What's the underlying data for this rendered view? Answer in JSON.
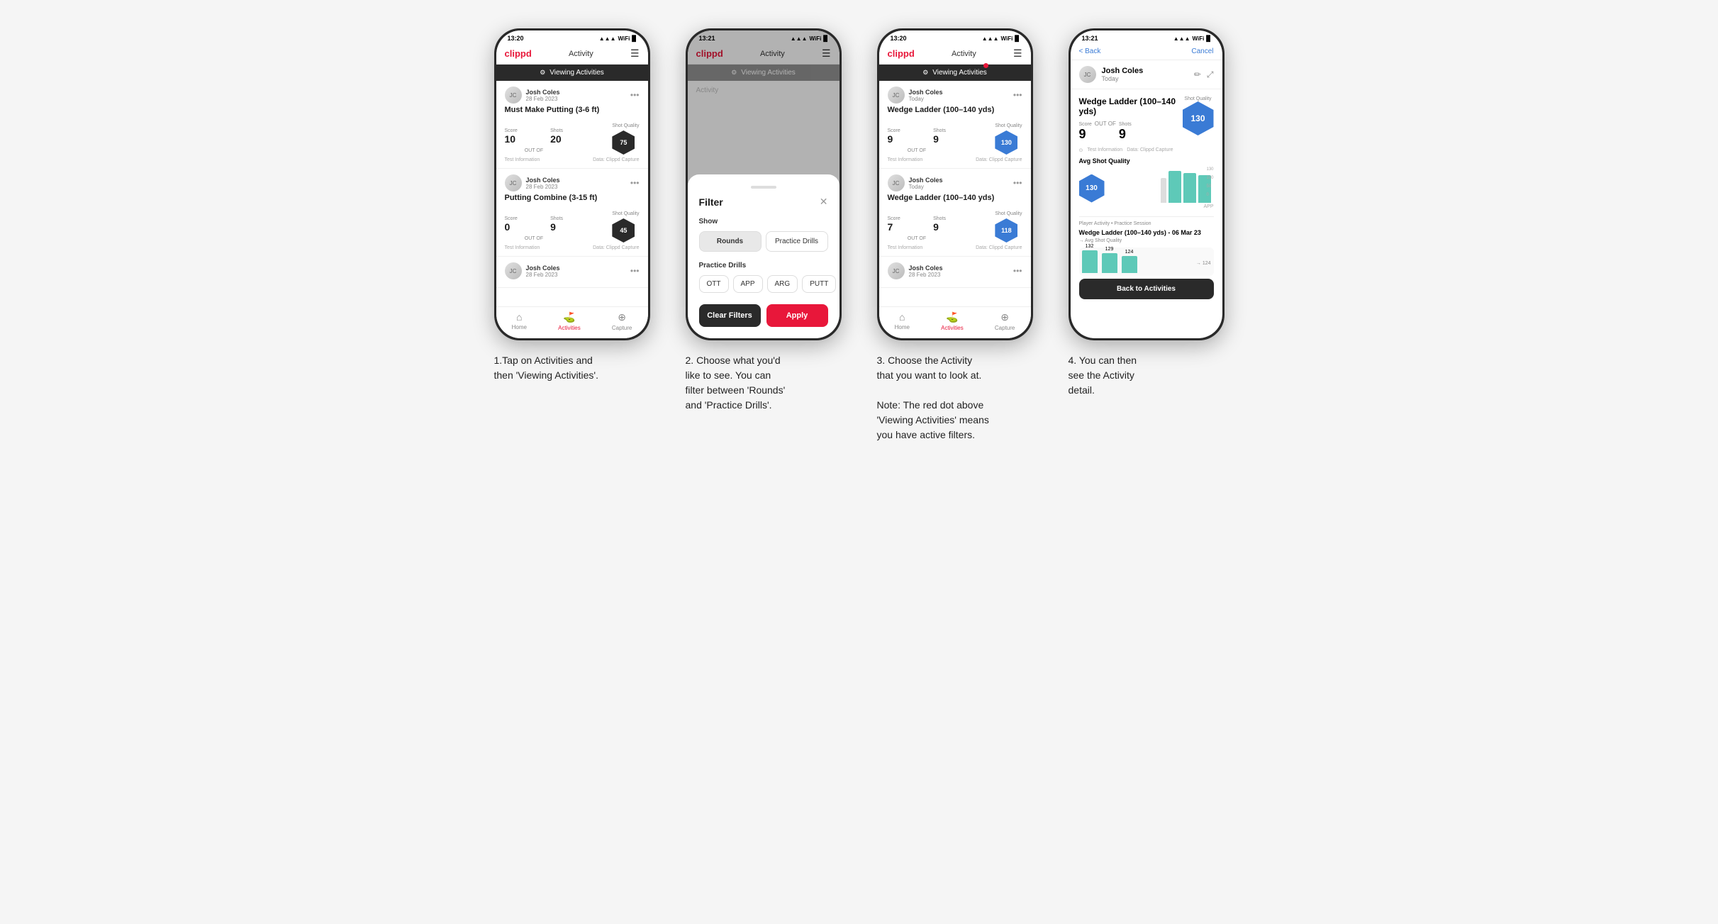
{
  "phones": [
    {
      "id": "phone1",
      "status_time": "13:20",
      "header_logo": "clippd",
      "header_title": "Activity",
      "viewing_label": "Viewing Activities",
      "has_red_dot": false,
      "activities": [
        {
          "user_name": "Josh Coles",
          "user_date": "28 Feb 2023",
          "title": "Must Make Putting (3-6 ft)",
          "score_label": "Score",
          "score_value": "10",
          "shots_label": "Shots",
          "shots_value": "20",
          "quality_label": "Shot Quality",
          "quality_value": "75",
          "info_left": "Test Information",
          "info_right": "Data: Clippd Capture"
        },
        {
          "user_name": "Josh Coles",
          "user_date": "28 Feb 2023",
          "title": "Putting Combine (3-15 ft)",
          "score_label": "Score",
          "score_value": "0",
          "shots_label": "Shots",
          "shots_value": "9",
          "quality_label": "Shot Quality",
          "quality_value": "45",
          "info_left": "Test Information",
          "info_right": "Data: Clippd Capture"
        },
        {
          "user_name": "Josh Coles",
          "user_date": "28 Feb 2023",
          "title": "",
          "score_label": "",
          "score_value": "",
          "shots_label": "",
          "shots_value": "",
          "quality_label": "",
          "quality_value": "",
          "info_left": "",
          "info_right": ""
        }
      ],
      "nav": [
        "Home",
        "Activities",
        "Capture"
      ]
    },
    {
      "id": "phone2",
      "status_time": "13:21",
      "header_logo": "clippd",
      "header_title": "Activity",
      "viewing_label": "Viewing Activities",
      "filter_title": "Filter",
      "show_label": "Show",
      "rounds_label": "Rounds",
      "practice_drills_label": "Practice Drills",
      "practice_drills_section": "Practice Drills",
      "drill_opts": [
        "OTT",
        "APP",
        "ARG",
        "PUTT"
      ],
      "clear_label": "Clear Filters",
      "apply_label": "Apply"
    },
    {
      "id": "phone3",
      "status_time": "13:20",
      "header_logo": "clippd",
      "header_title": "Activity",
      "viewing_label": "Viewing Activities",
      "has_red_dot": true,
      "activities": [
        {
          "user_name": "Josh Coles",
          "user_date": "Today",
          "title": "Wedge Ladder (100–140 yds)",
          "score_label": "Score",
          "score_value": "9",
          "shots_label": "Shots",
          "shots_value": "9",
          "quality_label": "Shot Quality",
          "quality_value": "130",
          "quality_color": "blue",
          "info_left": "Test Information",
          "info_right": "Data: Clippd Capture"
        },
        {
          "user_name": "Josh Coles",
          "user_date": "Today",
          "title": "Wedge Ladder (100–140 yds)",
          "score_label": "Score",
          "score_value": "7",
          "shots_label": "Shots",
          "shots_value": "9",
          "quality_label": "Shot Quality",
          "quality_value": "118",
          "quality_color": "blue",
          "info_left": "Test Information",
          "info_right": "Data: Clippd Capture"
        },
        {
          "user_name": "Josh Coles",
          "user_date": "28 Feb 2023",
          "title": "",
          "partial": true
        }
      ],
      "nav": [
        "Home",
        "Activities",
        "Capture"
      ]
    },
    {
      "id": "phone4",
      "status_time": "13:21",
      "back_label": "< Back",
      "cancel_label": "Cancel",
      "user_name": "Josh Coles",
      "user_date": "Today",
      "detail_title": "Wedge Ladder (100–140 yds)",
      "score_label": "Score",
      "shots_label": "Shots",
      "score_value": "9",
      "shots_value": "9",
      "outof_label": "OUT OF",
      "quality_value": "130",
      "info_note1": "Test Information",
      "info_note2": "Data: Clippd Capture",
      "avg_quality_label": "Avg Shot Quality",
      "chart_value": "130",
      "chart_axis_label": "APP",
      "chart_bars": [
        132,
        129,
        124
      ],
      "session_label": "Player Activity • Practice Session",
      "drill_label": "Wedge Ladder (100–140 yds) - 06 Mar 23",
      "drill_sublabel": "→ Avg Shot Quality",
      "back_activities_label": "Back to Activities"
    }
  ],
  "captions": [
    "1.Tap on Activities and\nthen 'Viewing Activities'.",
    "2. Choose what you'd\nlike to see. You can\nfilter between 'Rounds'\nand 'Practice Drills'.",
    "3. Choose the Activity\nthat you want to look at.\n\nNote: The red dot above\n'Viewing Activities' means\nyou have active filters.",
    "4. You can then\nsee the Activity\ndetail."
  ]
}
